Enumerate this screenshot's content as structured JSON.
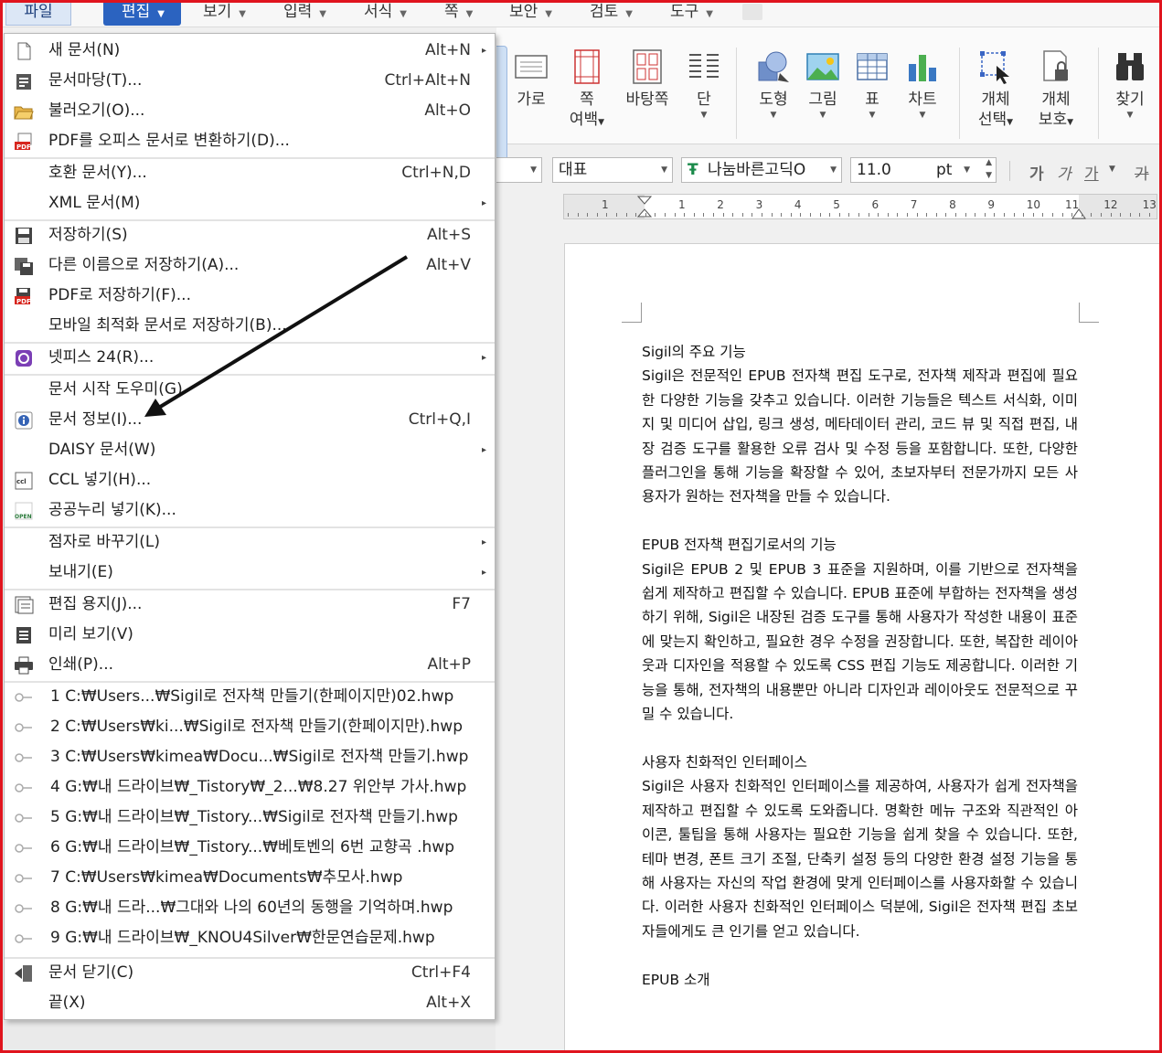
{
  "menubar": {
    "file": "파일",
    "edit": "편집",
    "view": "보기",
    "input": "입력",
    "format": "서식",
    "page": "쪽",
    "security": "보안",
    "review": "검토",
    "tools": "도구"
  },
  "ribbon": {
    "horizontal": "가로",
    "page_margin_1": "쪽",
    "page_margin_2": "여백",
    "background_page": "바탕쪽",
    "column": "단",
    "shape": "도형",
    "picture": "그림",
    "table": "표",
    "chart": "차트",
    "object_select_1": "개체",
    "object_select_2": "선택",
    "object_protect_1": "개체",
    "object_protect_2": "보호",
    "find": "찾기"
  },
  "formatbar": {
    "style": "대표",
    "font": "나눔바른고딕O",
    "size": "11.0",
    "unit": "pt",
    "bold": "가",
    "italic": "가",
    "underline": "가",
    "strike": "가"
  },
  "ruler": {
    "numbers": [
      "1",
      "1",
      "2",
      "3",
      "4",
      "5",
      "6",
      "7",
      "8",
      "9",
      "10",
      "11",
      "12",
      "13"
    ]
  },
  "file_menu": {
    "new_doc": {
      "label": "새 문서(N)",
      "shortcut": "Alt+N"
    },
    "doc_template": {
      "label": "문서마당(T)...",
      "shortcut": "Ctrl+Alt+N"
    },
    "open": {
      "label": "불러오기(O)...",
      "shortcut": "Alt+O"
    },
    "pdf_convert": {
      "label": "PDF를 오피스 문서로 변환하기(D)..."
    },
    "compat_doc": {
      "label": "호환 문서(Y)...",
      "shortcut": "Ctrl+N,D"
    },
    "xml_doc": {
      "label": "XML 문서(M)"
    },
    "save": {
      "label": "저장하기(S)",
      "shortcut": "Alt+S"
    },
    "save_as": {
      "label": "다른 이름으로 저장하기(A)...",
      "shortcut": "Alt+V"
    },
    "save_pdf": {
      "label": "PDF로 저장하기(F)..."
    },
    "save_mobile": {
      "label": "모바일 최적화 문서로 저장하기(B)..."
    },
    "netffice": {
      "label": "넷피스 24(R)..."
    },
    "start_wizard": {
      "label": "문서 시작 도우미(G)"
    },
    "doc_info": {
      "label": "문서 정보(I)...",
      "shortcut": "Ctrl+Q,I"
    },
    "daisy": {
      "label": "DAISY 문서(W)"
    },
    "ccl": {
      "label": "CCL 넣기(H)..."
    },
    "kogl": {
      "label": "공공누리 넣기(K)..."
    },
    "braille": {
      "label": "점자로 바꾸기(L)"
    },
    "send": {
      "label": "보내기(E)"
    },
    "edit_paper": {
      "label": "편집 용지(J)...",
      "shortcut": "F7"
    },
    "preview": {
      "label": "미리 보기(V)"
    },
    "print": {
      "label": "인쇄(P)...",
      "shortcut": "Alt+P"
    },
    "recent": [
      "1 C:₩Users...₩Sigil로 전자책 만들기(한페이지만)02.hwp",
      "2 C:₩Users₩ki...₩Sigil로 전자책 만들기(한페이지만).hwp",
      "3 C:₩Users₩kimea₩Docu...₩Sigil로 전자책 만들기.hwp",
      "4 G:₩내 드라이브₩_Tistory₩_2...₩8.27 위안부 가사.hwp",
      "5 G:₩내 드라이브₩_Tistory...₩Sigil로 전자책 만들기.hwp",
      "6 G:₩내 드라이브₩_Tistory...₩베토벤의 6번 교향곡 .hwp",
      "7 C:₩Users₩kimea₩Documents₩추모사.hwp",
      "8 G:₩내 드라...₩그대와 나의 60년의 동행을 기억하며.hwp",
      "9 G:₩내 드라이브₩_KNOU4Silver₩한문연습문제.hwp"
    ],
    "close_doc": {
      "label": "문서 닫기(C)",
      "shortcut": "Ctrl+F4"
    },
    "exit": {
      "label": "끝(X)",
      "shortcut": "Alt+X"
    }
  },
  "document": {
    "h1": "Sigil의 주요 기능",
    "p1": "Sigil은 전문적인 EPUB 전자책 편집 도구로, 전자책 제작과 편집에 필요한 다양한 기능을 갖추고 있습니다. 이러한 기능들은 텍스트 서식화, 이미지 및 미디어 삽입, 링크 생성, 메타데이터 관리, 코드 뷰 및 직접 편집, 내장 검증 도구를 활용한 오류 검사 및 수정 등을 포함합니다. 또한, 다양한 플러그인을 통해 기능을 확장할 수 있어, 초보자부터 전문가까지 모든 사용자가 원하는 전자책을 만들 수 있습니다.",
    "h2": "EPUB 전자책 편집기로서의 기능",
    "p2": "Sigil은 EPUB 2 및 EPUB 3 표준을 지원하며, 이를 기반으로 전자책을 쉽게 제작하고 편집할 수 있습니다. EPUB 표준에 부합하는 전자책을 생성하기 위해, Sigil은 내장된 검증 도구를 통해 사용자가 작성한 내용이 표준에 맞는지 확인하고, 필요한 경우 수정을 권장합니다. 또한, 복잡한 레이아웃과 디자인을 적용할 수 있도록 CSS 편집 기능도 제공합니다. 이러한 기능을 통해, 전자책의 내용뿐만 아니라 디자인과 레이아웃도 전문적으로 꾸밀 수 있습니다.",
    "h3": "사용자 친화적인 인터페이스",
    "p3": "Sigil은 사용자 친화적인 인터페이스를 제공하여, 사용자가 쉽게 전자책을 제작하고 편집할 수 있도록 도와줍니다. 명확한 메뉴 구조와 직관적인 아이콘, 툴팁을 통해 사용자는 필요한 기능을 쉽게 찾을 수 있습니다. 또한, 테마 변경, 폰트 크기 조절, 단축키 설정 등의 다양한 환경 설정 기능을 통해 사용자는 자신의 작업 환경에 맞게 인터페이스를 사용자화할 수 있습니다. 이러한 사용자 친화적인 인터페이스 덕분에, Sigil은 전자책 편집 초보자들에게도 큰 인기를 얻고 있습니다.",
    "h4": "EPUB 소개"
  },
  "colors": {
    "accent": "#2b63c0",
    "frame": "#e0141e",
    "arrow": "#111111"
  }
}
